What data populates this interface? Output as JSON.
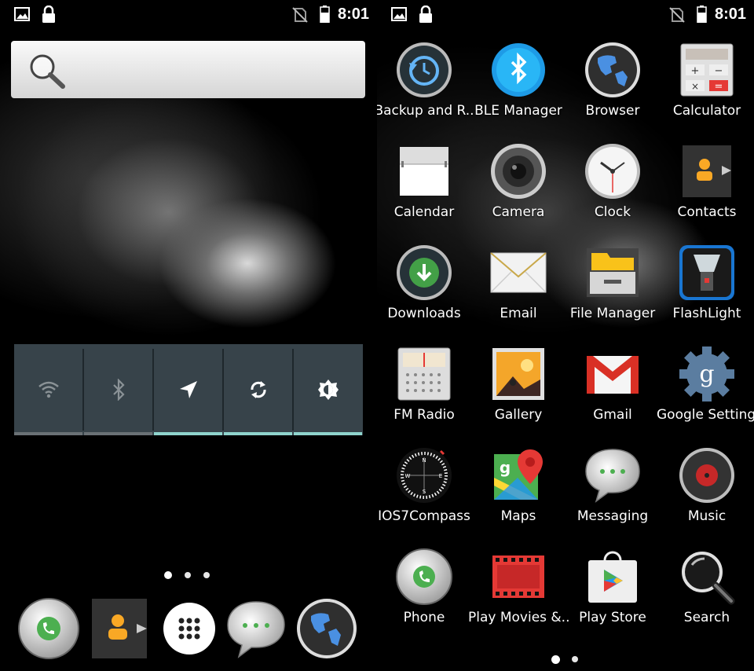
{
  "status_bar": {
    "left_icons": [
      "image-icon",
      "lock-icon"
    ],
    "right_icons": [
      "no-sim-icon",
      "battery-icon"
    ],
    "time": "8:01"
  },
  "home": {
    "search_widget": {
      "icon": "search-icon"
    },
    "quick_settings": [
      {
        "name": "wifi",
        "icon": "wifi-icon",
        "active": false
      },
      {
        "name": "bluetooth",
        "icon": "bluetooth-icon",
        "active": false
      },
      {
        "name": "location",
        "icon": "location-icon",
        "active": true
      },
      {
        "name": "sync",
        "icon": "sync-icon",
        "active": true
      },
      {
        "name": "brightness",
        "icon": "brightness-icon",
        "active": true
      }
    ],
    "page_indicator": {
      "pages": 3,
      "current": 1
    },
    "dock": [
      "Phone",
      "Contacts",
      "All apps",
      "Messaging",
      "Browser"
    ]
  },
  "drawer": {
    "apps": [
      {
        "label": "Backup and R..",
        "icon": "backup-icon"
      },
      {
        "label": "BLE Manager",
        "icon": "bluetooth-le-icon"
      },
      {
        "label": "Browser",
        "icon": "globe-icon"
      },
      {
        "label": "Calculator",
        "icon": "calculator-icon"
      },
      {
        "label": "Calendar",
        "icon": "calendar-icon"
      },
      {
        "label": "Camera",
        "icon": "camera-icon"
      },
      {
        "label": "Clock",
        "icon": "clock-icon"
      },
      {
        "label": "Contacts",
        "icon": "contacts-icon"
      },
      {
        "label": "Downloads",
        "icon": "download-icon"
      },
      {
        "label": "Email",
        "icon": "envelope-icon"
      },
      {
        "label": "File Manager",
        "icon": "folder-icon"
      },
      {
        "label": "FlashLight",
        "icon": "flashlight-icon"
      },
      {
        "label": "FM Radio",
        "icon": "radio-icon"
      },
      {
        "label": "Gallery",
        "icon": "photo-icon"
      },
      {
        "label": "Gmail",
        "icon": "gmail-icon"
      },
      {
        "label": "Google Settings",
        "icon": "google-settings-icon"
      },
      {
        "label": "IOS7Compass",
        "icon": "compass-icon"
      },
      {
        "label": "Maps",
        "icon": "map-pin-icon"
      },
      {
        "label": "Messaging",
        "icon": "speech-bubble-icon"
      },
      {
        "label": "Music",
        "icon": "music-disc-icon"
      },
      {
        "label": "Phone",
        "icon": "phone-icon"
      },
      {
        "label": "Play Movies &..",
        "icon": "film-icon"
      },
      {
        "label": "Play Store",
        "icon": "play-store-icon"
      },
      {
        "label": "Search",
        "icon": "magnifier-icon"
      }
    ],
    "page_indicator": {
      "pages": 2,
      "current": 1
    }
  },
  "colors": {
    "quick_settings_bg": "#37434a",
    "quick_settings_active": "#8fd4cd",
    "quick_settings_inactive": "#6a7175"
  }
}
